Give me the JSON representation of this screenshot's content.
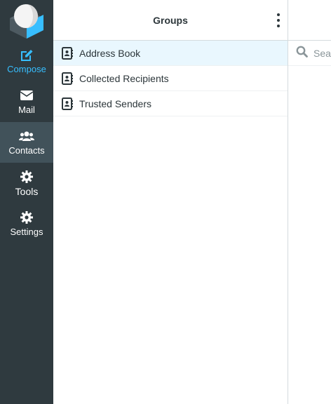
{
  "nav": {
    "items": [
      {
        "label": "Compose",
        "icon": "compose-icon"
      },
      {
        "label": "Mail",
        "icon": "envelope-icon"
      },
      {
        "label": "Contacts",
        "icon": "users-icon"
      },
      {
        "label": "Tools",
        "icon": "gear-icon"
      },
      {
        "label": "Settings",
        "icon": "gear-icon"
      }
    ],
    "selected": "Contacts",
    "colors": {
      "background": "#2f3a3f",
      "selected": "#41525a",
      "accent": "#37beff"
    }
  },
  "groups": {
    "title": "Groups",
    "items": [
      {
        "label": "Address Book",
        "icon": "address-book-icon",
        "selected": true
      },
      {
        "label": "Collected Recipients",
        "icon": "address-book-icon",
        "selected": false
      },
      {
        "label": "Trusted Senders",
        "icon": "address-book-icon",
        "selected": false
      }
    ]
  },
  "search": {
    "placeholder": "Search",
    "icon": "search-icon"
  }
}
